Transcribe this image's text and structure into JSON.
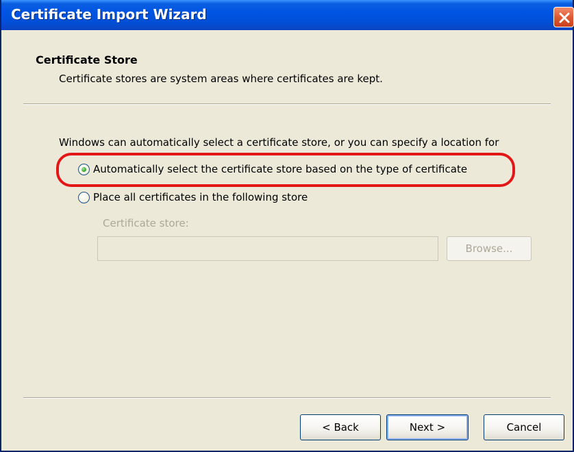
{
  "window": {
    "title": "Certificate Import Wizard",
    "close_label": "×"
  },
  "header": {
    "title": "Certificate Store",
    "description": "Certificate stores are system areas where certificates are kept."
  },
  "main": {
    "intro": "Windows can automatically select a certificate store, or you can specify a location for",
    "options": [
      {
        "label": "Automatically select the certificate store based on the type of certificate",
        "selected": true
      },
      {
        "label": "Place all certificates in the following store",
        "selected": false
      }
    ],
    "store_label": "Certificate store:",
    "store_value": "",
    "browse_label": "Browse..."
  },
  "footer": {
    "back_label": "< Back",
    "next_label": "Next >",
    "cancel_label": "Cancel"
  },
  "annotation": {
    "highlight_color": "#e21818"
  }
}
